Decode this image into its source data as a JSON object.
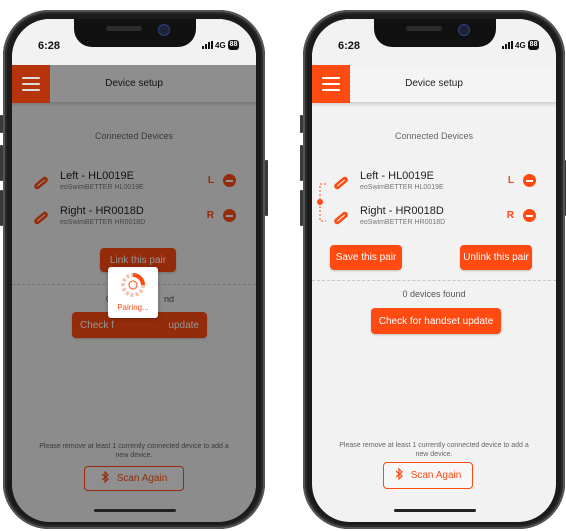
{
  "status_bar": {
    "time": "6:28",
    "network": "4G",
    "battery": "88"
  },
  "header": {
    "title": "Device setup"
  },
  "connected": {
    "title": "Connected Devices",
    "devices": [
      {
        "name": "Left - HL0019E",
        "model": "eoSwimBETTER HL0019E",
        "side": "L",
        "icon": "swim-paddle-icon"
      },
      {
        "name": "Right - HR0018D",
        "model": "eoSwimBETTER HR0018D",
        "side": "R",
        "icon": "swim-paddle-icon"
      }
    ]
  },
  "actions": {
    "link_pair": "Link this pair",
    "save_pair": "Save this pair",
    "unlink_pair": "Unlink this pair",
    "check_update": "Check for handset update"
  },
  "found_text": "0 devices found",
  "found_text_obscured": "0",
  "found_text_tail": "nd",
  "check_update_left_a": "Check f",
  "check_update_left_b": "update",
  "notice": "Please remove at least 1 currently connected device to add a new device.",
  "scan_again": {
    "label": "Scan Again",
    "icon": "bluetooth-icon"
  },
  "pairing_dialog": {
    "label": "Pairing...",
    "icon": "spinner-icon",
    "pairing_progress": 0.25
  },
  "colors": {
    "accent": "#ff4a12",
    "background": "#f2f2f2"
  }
}
